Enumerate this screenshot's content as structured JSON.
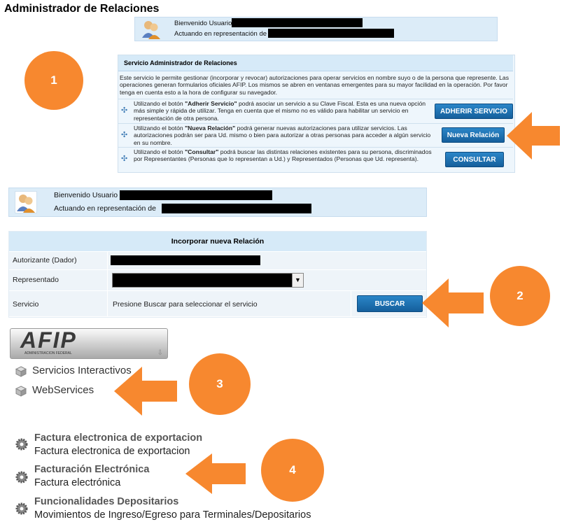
{
  "page": {
    "title": "Administrador de Relaciones"
  },
  "welcome": {
    "greeting": "Bienvenido Usuario",
    "acting": "Actuando en representación de"
  },
  "service_panel": {
    "header": "Servicio Administrador de Relaciones",
    "intro": "Este servicio le permite gestionar (incorporar y revocar) autorizaciones para operar servicios en nombre suyo o de la persona que represente. Las operaciones generan formularios oficiales AFIP. Los mismos se abren en ventanas emergentes para su mayor facilidad en la operación. Por favor tenga en cuenta esto a la hora de configurar su navegador.",
    "rows": [
      {
        "pre": "Utilizando el botón ",
        "bold": "\"Adherir Servicio\"",
        "post": " podrá asociar un servicio a su Clave Fiscal. Esta es una nueva opción más simple y rápida de utilizar. Tenga en cuenta que el mismo no es válido para habilitar un servicio en representación de otra persona.",
        "button": "ADHERIR SERVICIO"
      },
      {
        "pre": "Utilizando el botón ",
        "bold": "\"Nueva Relación\"",
        "post": " podrá generar nuevas autorizaciones para utilizar servicios. Las autorizaciones podrán ser para Ud. mismo o bien para autorizar a otras personas para acceder a algún servicio en su nombre.",
        "button": "Nueva Relación"
      },
      {
        "pre": "Utilizando el botón ",
        "bold": "\"Consultar\"",
        "post": " podrá buscar las distintas relaciones existentes para su persona, discriminados por Representantes (Personas que lo representan a Ud.) y Representados (Personas que Ud. representa).",
        "button": "CONSULTAR"
      }
    ]
  },
  "form": {
    "header": "Incorporar nueva Relación",
    "autorizante_label": "Autorizante (Dador)",
    "representado_label": "Representado",
    "servicio_label": "Servicio",
    "servicio_hint": "Presione Buscar para seleccionar el servicio",
    "buscar_label": "BUSCAR",
    "select_arrow": "▼"
  },
  "afip": {
    "logo_text": "AFIP",
    "logo_caption": "ADMINISTRACION FEDERAL",
    "links": [
      "Servicios Interactivos",
      "WebServices"
    ]
  },
  "services": [
    {
      "title": "Factura electronica de exportacion",
      "subtitle": "Factura electronica de exportacion"
    },
    {
      "title": "Facturación Electrónica",
      "subtitle": "Factura electrónica"
    },
    {
      "title": "Funcionalidades Depositarios",
      "subtitle": "Movimientos de Ingreso/Egreso para Terminales/Depositarios"
    }
  ],
  "callouts": [
    "1",
    "2",
    "3",
    "4"
  ],
  "colors": {
    "callout_orange": "#f7882f",
    "button_blue": "#1f74b8",
    "panel_bg": "#dcecf8"
  }
}
